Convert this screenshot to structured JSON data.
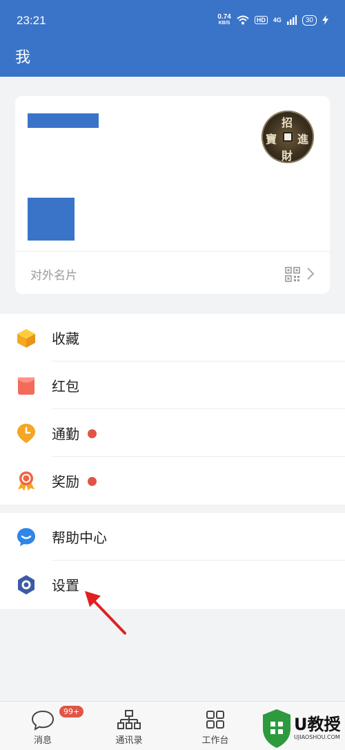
{
  "status_bar": {
    "time": "23:21",
    "speed_value": "0.74",
    "speed_unit": "KB/S",
    "hd": "HD",
    "network": "4G",
    "battery": "30"
  },
  "header": {
    "title": "我"
  },
  "profile_card": {
    "footer_label": "对外名片",
    "avatar_chars": [
      "招",
      "進",
      "財",
      "寶"
    ]
  },
  "menu_section_1": {
    "items": [
      {
        "label": "收藏",
        "icon": "cube-icon",
        "dot": false
      },
      {
        "label": "红包",
        "icon": "red-envelope-icon",
        "dot": false
      },
      {
        "label": "通勤",
        "icon": "location-clock-icon",
        "dot": true
      },
      {
        "label": "奖励",
        "icon": "medal-icon",
        "dot": true
      }
    ]
  },
  "menu_section_2": {
    "items": [
      {
        "label": "帮助中心",
        "icon": "chat-bubble-icon"
      },
      {
        "label": "设置",
        "icon": "hexagon-settings-icon"
      }
    ]
  },
  "tab_bar": {
    "messages": {
      "label": "消息",
      "badge": "99+"
    },
    "contacts": {
      "label": "通讯录"
    },
    "workbench": {
      "label": "工作台"
    }
  },
  "watermark": {
    "text": "U教授",
    "url": "UJIAOSHOU.COM"
  },
  "colors": {
    "brand_blue": "#3a74c9",
    "dot_red": "#e05546",
    "arrow_red": "#e02020"
  }
}
